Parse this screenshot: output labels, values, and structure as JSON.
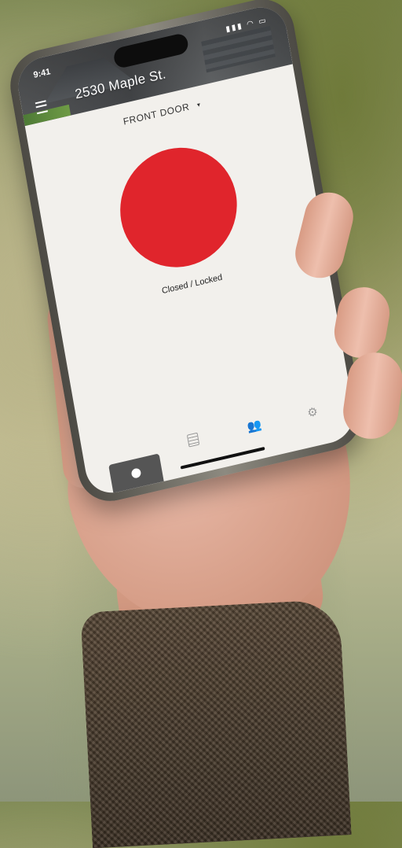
{
  "status_bar": {
    "time": "9:41",
    "icons": [
      "signal-icon",
      "wifi-icon",
      "battery-icon"
    ]
  },
  "header": {
    "address": "2530 Maple St.",
    "menu_icon": "menu-icon"
  },
  "door_selector": {
    "label": "FRONT DOOR",
    "caret": "▾"
  },
  "lock": {
    "status": "Closed / Locked",
    "color": "#e0252c"
  },
  "tabbar": {
    "tabs": [
      "home-tab",
      "activity-log-tab",
      "users-tab",
      "settings-tab"
    ]
  }
}
